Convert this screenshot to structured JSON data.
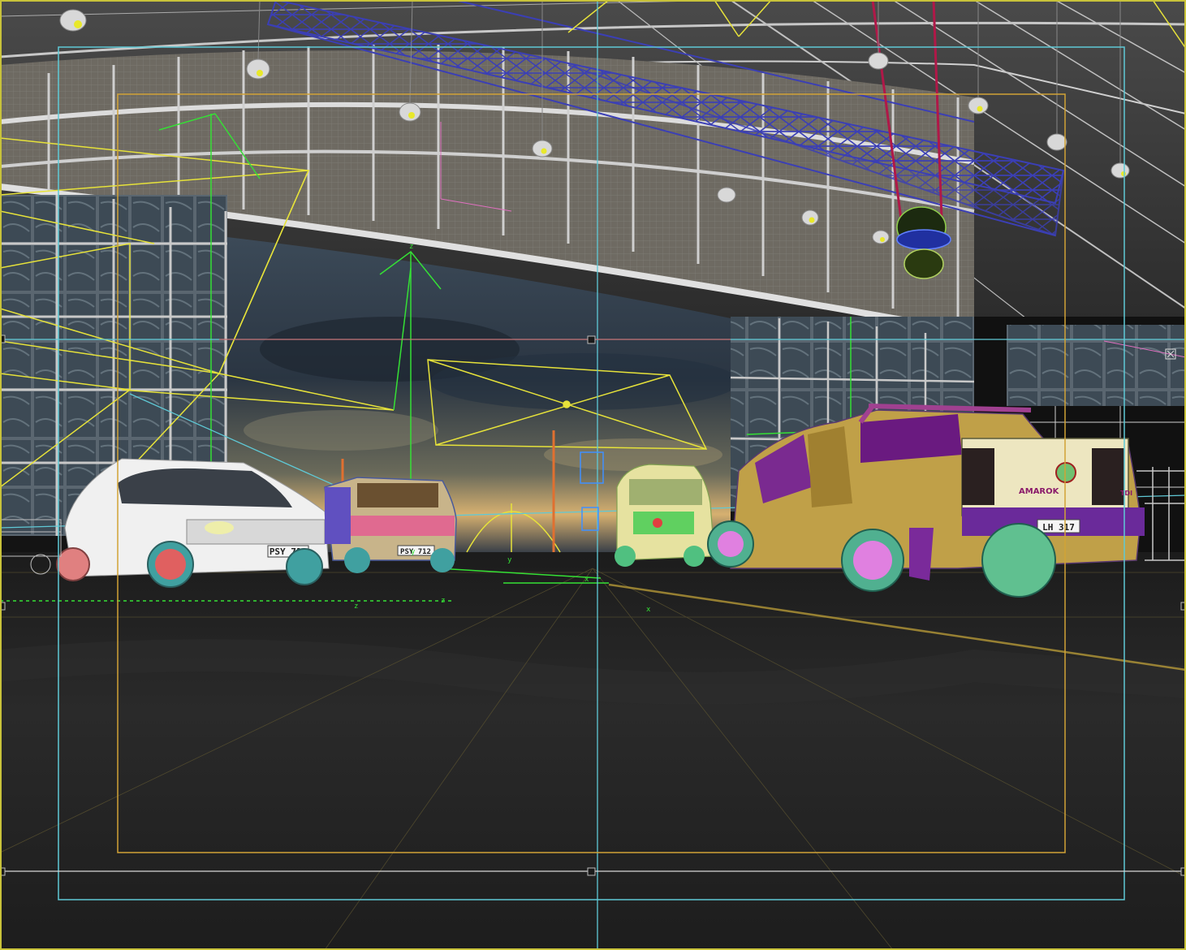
{
  "colors": {
    "viewport_border": "#c8c23a",
    "safe_frame_outer": "#5fc9d6",
    "safe_frame_inner": "#d1a236",
    "truss": "#3b3fb5",
    "light_helper": "#e6e23a",
    "gizmo": "#35e035",
    "cable": "#b01848",
    "floor": "#232323",
    "sky_dark": "#2e3b48",
    "sky_glow": "#d6b070"
  },
  "scene": {
    "vehicles": [
      {
        "name": "caddy-van",
        "plate": "PSY 712"
      },
      {
        "name": "transporter-van",
        "plate": "PSY 712"
      },
      {
        "name": "crafter-van",
        "plate": ""
      },
      {
        "name": "amarok-pickup",
        "plate": "LH 317",
        "badge": "AMAROK",
        "model_badge": "TDI"
      }
    ]
  },
  "gizmo_labels": {
    "z_top": "z",
    "y_a": "y",
    "y_b": "y",
    "x_a": "x",
    "x_b": "x",
    "z_floor_a": "z",
    "z_floor_b": "z"
  }
}
